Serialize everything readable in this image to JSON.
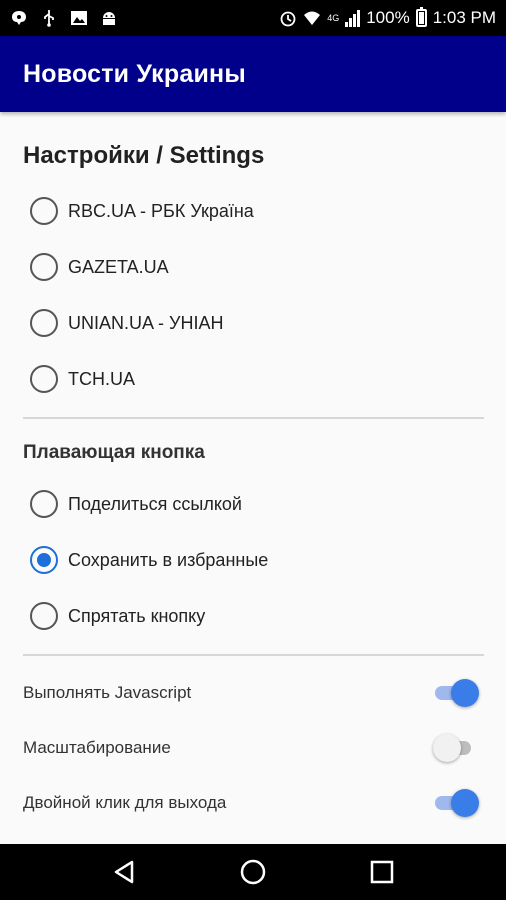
{
  "status_bar": {
    "battery": "100%",
    "time": "1:03 PM",
    "network": "4G"
  },
  "app_bar": {
    "title": "Новости Украины"
  },
  "settings": {
    "title": "Настройки / Settings",
    "sources": [
      {
        "label": "RBC.UA - РБК Україна",
        "checked": false
      },
      {
        "label": "GAZETA.UA",
        "checked": false
      },
      {
        "label": "UNIAN.UA - УНІАН",
        "checked": false
      },
      {
        "label": "TCH.UA",
        "checked": false
      }
    ]
  },
  "floating_button": {
    "title": "Плавающая кнопка",
    "options": [
      {
        "label": "Поделиться ссылкой",
        "checked": false
      },
      {
        "label": "Сохранить в избранные",
        "checked": true
      },
      {
        "label": "Спрятать кнопку",
        "checked": false
      }
    ]
  },
  "toggles": [
    {
      "label": "Выполнять Javascript",
      "on": true
    },
    {
      "label": "Масштабирование",
      "on": false
    },
    {
      "label": "Двойной клик для выхода",
      "on": true
    }
  ],
  "colors": {
    "app_bar": "#00008b",
    "accent": "#1e6fd9"
  },
  "icons": [
    "chat-icon",
    "usb-icon",
    "image-icon",
    "android-icon",
    "alarm-icon",
    "wifi-icon",
    "signal-icon",
    "battery-icon",
    "back-icon",
    "home-icon",
    "recents-icon"
  ]
}
